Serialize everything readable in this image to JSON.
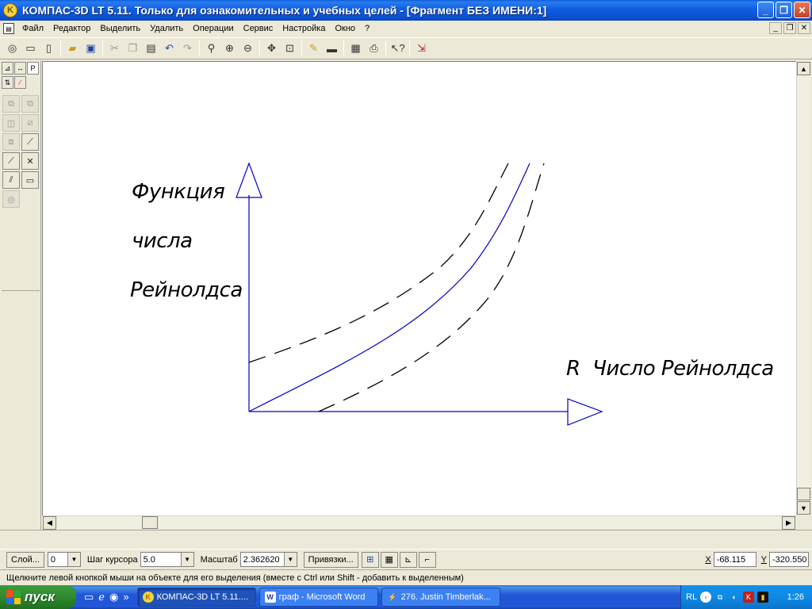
{
  "window": {
    "title": "КОМПАС-3D LT 5.11. Только для ознакомительных и учебных целей - [Фрагмент БЕЗ ИМЕНИ:1]",
    "app_icon": "kompas-logo-icon",
    "minimize": "_",
    "maximize": "❐",
    "close": "✕"
  },
  "menu": {
    "items": [
      "Файл",
      "Редактор",
      "Выделить",
      "Удалить",
      "Операции",
      "Сервис",
      "Настройка",
      "Окно",
      "?"
    ],
    "mdi_minimize": "_",
    "mdi_restore": "❐",
    "mdi_close": "✕"
  },
  "toolbar": {
    "icons": [
      "new-icon",
      "new-doc-icon",
      "new-sheet-icon",
      "open-folder-icon",
      "save-icon",
      "cut-icon",
      "copy-icon",
      "paste-icon",
      "undo-icon",
      "redo-icon",
      "zoom-icon",
      "zoom-in-icon",
      "zoom-out-icon",
      "pan-icon",
      "zoom-fit-icon",
      "redraw-icon",
      "view-icon",
      "print-preview-icon",
      "print-icon",
      "help-pointer-icon",
      "exit-icon"
    ]
  },
  "drawing": {
    "y_axis_label_lines": [
      "Функция",
      "числа",
      "Рейнолдса"
    ],
    "x_axis_label": "R  Число Рейнолдса",
    "curve_color": "#0000c8",
    "axis_color": "#0000c8"
  },
  "params": {
    "layer_button": "Слой...",
    "layer_value": "0",
    "step_label": "Шаг курсора",
    "step_value": "5.0",
    "scale_label": "Масштаб",
    "scale_value": "2.362620",
    "snaps_button": "Привязки...",
    "x_label": "X",
    "x_value": "-68.115",
    "y_label": "Y",
    "y_value": "-320.550"
  },
  "hint": "Щелкните левой кнопкой мыши на объекте для его выделения (вместе с Ctrl или Shift - добавить к выделенным)",
  "taskbar": {
    "start": "пуск",
    "more": "»",
    "tasks": [
      {
        "label": "КОМПАС-3D LT 5.11....",
        "icon": "kompas-icon",
        "active": true
      },
      {
        "label": "граф - Microsoft Word",
        "icon": "word-icon",
        "active": false
      },
      {
        "label": "276. Justin Timberlak...",
        "icon": "winamp-icon",
        "active": false
      }
    ],
    "lang": "RL",
    "clock": "1:26"
  }
}
